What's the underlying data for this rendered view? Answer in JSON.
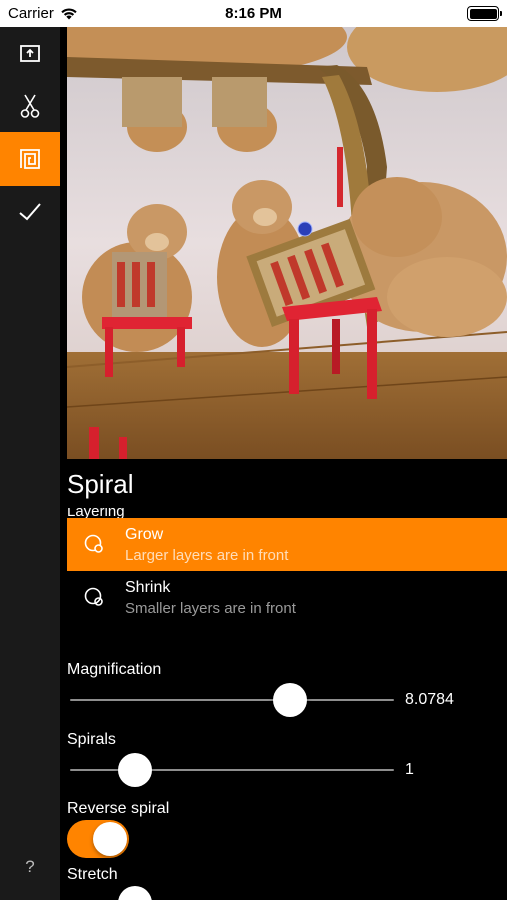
{
  "status_bar": {
    "carrier": "Carrier",
    "time": "8:16 PM"
  },
  "sidebar": {
    "tools": [
      {
        "icon": "export-icon",
        "active": false
      },
      {
        "icon": "scissors-icon",
        "active": false
      },
      {
        "icon": "spiral-icon",
        "active": true
      },
      {
        "icon": "checkmark-icon",
        "active": false
      }
    ],
    "help_label": "?"
  },
  "preview": {
    "description_icon": "droste-teddy-bear-image"
  },
  "panel": {
    "title": "Spiral",
    "layering": {
      "label": "Layering",
      "options": [
        {
          "title": "Grow",
          "subtitle": "Larger layers are in front",
          "selected": true
        },
        {
          "title": "Shrink",
          "subtitle": "Smaller layers are in front",
          "selected": false
        }
      ]
    },
    "magnification": {
      "label": "Magnification",
      "value_text": "8.0784",
      "fraction": 0.68
    },
    "spirals": {
      "label": "Spirals",
      "value_text": "1",
      "fraction": 0.2
    },
    "reverse_spiral": {
      "label": "Reverse spiral",
      "on": true
    },
    "stretch": {
      "label": "Stretch",
      "fraction": 0.2
    }
  },
  "colors": {
    "accent": "#ff8400",
    "sidebar": "#1a1a1a",
    "background": "#000000"
  }
}
